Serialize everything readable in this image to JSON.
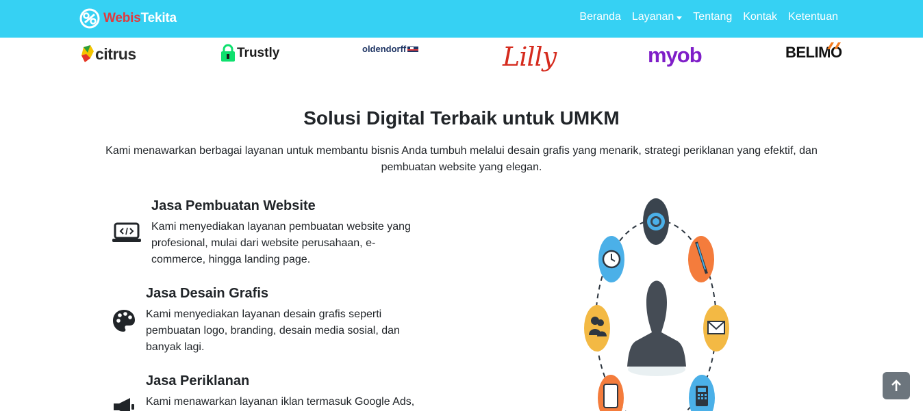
{
  "brand": {
    "name_part1": "Webis",
    "name_part2": "Tekita"
  },
  "nav": {
    "items": [
      {
        "label": "Beranda"
      },
      {
        "label": "Layanan"
      },
      {
        "label": "Tentang"
      },
      {
        "label": "Kontak"
      },
      {
        "label": "Ketentuan"
      }
    ]
  },
  "partners": [
    "citrus",
    "Trustly",
    "oldendorff",
    "Lilly",
    "myob",
    "BELIMO"
  ],
  "section": {
    "title": "Solusi Digital Terbaik untuk UMKM",
    "description": "Kami menawarkan berbagai layanan untuk membantu bisnis Anda tumbuh melalui desain grafis yang menarik, strategi periklanan yang efektif, dan pembuatan website yang elegan."
  },
  "services": [
    {
      "title": "Jasa Pembuatan Website",
      "text": "Kami menyediakan layanan pembuatan website yang profesional, mulai dari website perusahaan, e-commerce, hingga landing page.",
      "icon": "laptop-code-icon"
    },
    {
      "title": "Jasa Desain Grafis",
      "text": "Kami menyediakan layanan desain grafis seperti pembuatan logo, branding, desain media sosial, dan banyak lagi.",
      "icon": "palette-icon"
    },
    {
      "title": "Jasa Periklanan",
      "text": "Kami menawarkan layanan iklan termasuk Google Ads,",
      "icon": "megaphone-icon"
    }
  ],
  "colors": {
    "navbar": "#36d1f3",
    "brand_accent": "#e03a3e",
    "back_to_top": "#6c757d"
  }
}
